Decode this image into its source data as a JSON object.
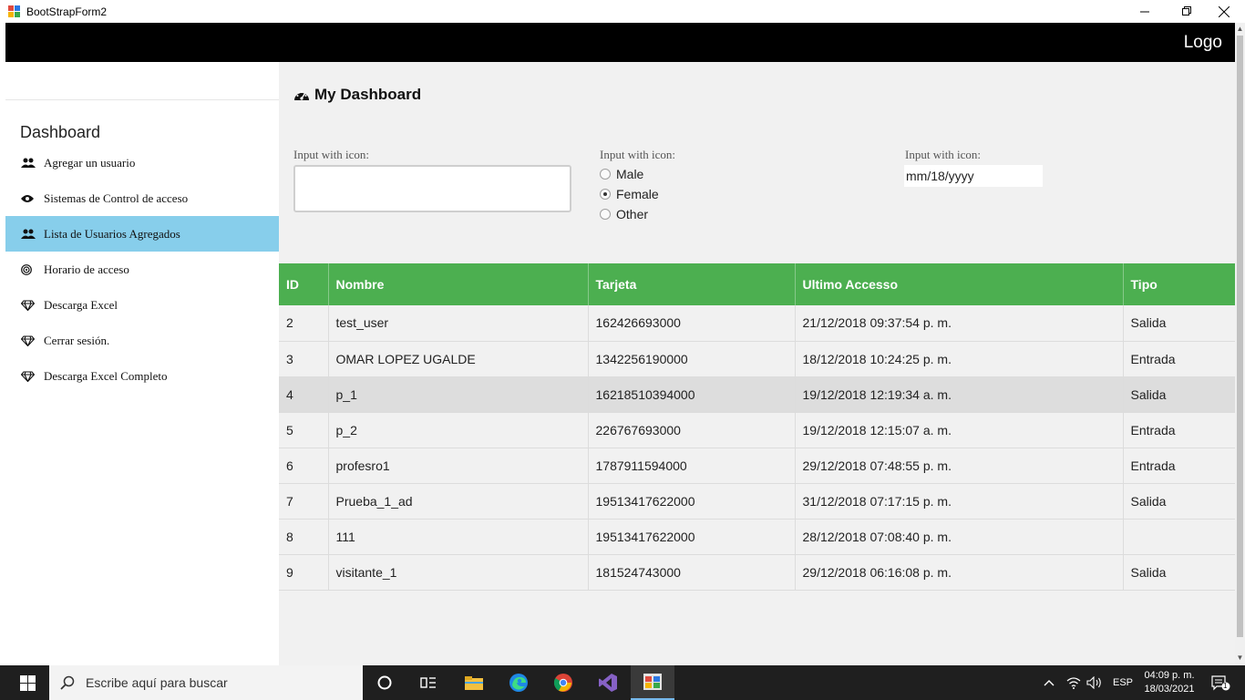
{
  "window": {
    "title": "BootStrapForm2",
    "minimize": "—",
    "restore": "❐",
    "close": "✕"
  },
  "topnav": {
    "logo": "Logo"
  },
  "sidebar": {
    "heading": "Dashboard",
    "items": [
      {
        "label": "Agregar un usuario",
        "icon": "users-icon"
      },
      {
        "label": "Sistemas de Control de acceso",
        "icon": "eye-icon"
      },
      {
        "label": "Lista de Usuarios Agregados",
        "icon": "users-icon",
        "active": true
      },
      {
        "label": "Horario de acceso",
        "icon": "bullseye-icon"
      },
      {
        "label": "Descarga Excel",
        "icon": "diamond-icon"
      },
      {
        "label": "Cerrar sesión.",
        "icon": "diamond-icon"
      },
      {
        "label": "Descarga Excel Completo",
        "icon": "diamond-icon"
      }
    ]
  },
  "main": {
    "title": "My Dashboard",
    "form": {
      "text_label": "Input with icon:",
      "text_value": "",
      "radio_label": "Input with icon:",
      "radio_options": [
        "Male",
        "Female",
        "Other"
      ],
      "radio_selected": "Female",
      "date_label": "Input with icon:",
      "date_value": "mm/18/yyyy"
    },
    "table": {
      "columns": [
        "ID",
        "Nombre",
        "Tarjeta",
        "Ultimo Accesso",
        "Tipo"
      ],
      "rows": [
        [
          "2",
          "test_user",
          "162426693000",
          "21/12/2018 09:37:54 p. m.",
          "Salida"
        ],
        [
          "3",
          "OMAR LOPEZ UGALDE",
          "1342256190000",
          "18/12/2018 10:24:25 p. m.",
          "Entrada"
        ],
        [
          "4",
          "p_1",
          "16218510394000",
          "19/12/2018 12:19:34 a. m.",
          "Salida"
        ],
        [
          "5",
          "p_2",
          "226767693000",
          "19/12/2018 12:15:07 a. m.",
          "Entrada"
        ],
        [
          "6",
          "profesro1",
          "1787911594000",
          "29/12/2018 07:48:55 p. m.",
          "Entrada"
        ],
        [
          "7",
          "Prueba_1_ad",
          "19513417622000",
          "31/12/2018 07:17:15 p. m.",
          "Salida"
        ],
        [
          "8",
          "111",
          "19513417622000",
          "28/12/2018 07:08:40 p. m.",
          ""
        ],
        [
          "9",
          "visitante_1",
          "181524743000",
          "29/12/2018 06:16:08 p. m.",
          "Salida"
        ]
      ],
      "highlighted_row": 2
    }
  },
  "taskbar": {
    "search_placeholder": "Escribe aquí para buscar",
    "lang": "ESP",
    "time": "04:09 p. m.",
    "date": "18/03/2021",
    "notifications": "1"
  },
  "colors": {
    "accent_green": "#4caf50",
    "active_sidebar": "#87ceeb",
    "topnav_bg": "#000000"
  }
}
